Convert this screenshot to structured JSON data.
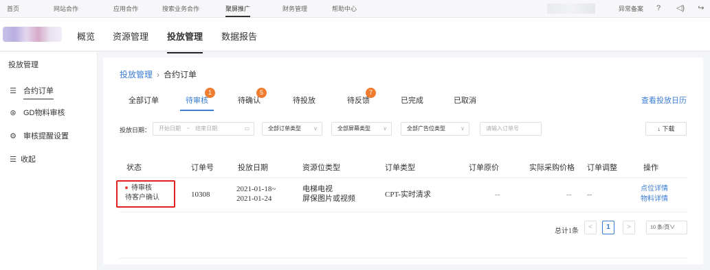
{
  "topnav": {
    "items": [
      "首页",
      "网站合作",
      "应用合作",
      "搜索业务合作",
      "聚屏推广",
      "财务管理",
      "帮助中心"
    ],
    "right_label": "异常备案",
    "icons": [
      "help-icon",
      "volume-icon",
      "logout-icon"
    ]
  },
  "subnav": {
    "tabs": [
      "概览",
      "资源管理",
      "投放管理",
      "数据报告"
    ],
    "active": "投放管理"
  },
  "sidebar": {
    "header": "投放管理",
    "items": [
      {
        "label": "合约订单",
        "icon": "list-icon"
      },
      {
        "label": "GD物料审核",
        "icon": "camera-icon"
      },
      {
        "label": "审核提醒设置",
        "icon": "gear-icon"
      },
      {
        "label": "收起",
        "icon": "collapse-icon"
      }
    ]
  },
  "breadcrumb": {
    "parent": "投放管理",
    "separator": "›",
    "current": "合约订单"
  },
  "status_tabs": [
    {
      "label": "全部订单",
      "badge": null
    },
    {
      "label": "待审核",
      "badge": "1"
    },
    {
      "label": "待确认",
      "badge": "5"
    },
    {
      "label": "待投放",
      "badge": null
    },
    {
      "label": "待反馈",
      "badge": "7"
    },
    {
      "label": "已完成",
      "badge": null
    },
    {
      "label": "已取消",
      "badge": null
    }
  ],
  "view_calendar": "查看投放日历",
  "filters": {
    "date_label": "投放日期：",
    "start_placeholder": "开始日期",
    "range_sep": "~",
    "end_placeholder": "结束日期",
    "order_type": "全部订单类型",
    "screen_type": "全部屏幕类型",
    "ad_slot_type": "全部广告位类型",
    "order_no_placeholder": "请输入订单号",
    "download": "↓ 下载"
  },
  "table": {
    "headers": [
      "状态",
      "订单号",
      "投放日期",
      "资源位类型",
      "订单类型",
      "订单原价",
      "实际采购价格",
      "订单调整",
      "操作"
    ],
    "rows": [
      {
        "status": "待审核",
        "status_sub": "待客户确认",
        "order_no": "10308",
        "date_from": "2021-01-18~",
        "date_to": "2021-01-24",
        "resource_type": "电梯电视",
        "resource_sub": "屏保图片或视频",
        "order_type": "CPT-实时清求",
        "original_price": "--",
        "actual_price": "--",
        "adjust": "--",
        "action_1": "点位详情",
        "action_2": "物料详情"
      }
    ]
  },
  "pager": {
    "total": "总计1条",
    "prev": "<",
    "current": "1",
    "next": ">",
    "page_size": "10 条/页∨"
  },
  "colors": {
    "accent": "#3a7bd5",
    "badge": "#f07d2f",
    "highlight_border": "#e02020"
  }
}
